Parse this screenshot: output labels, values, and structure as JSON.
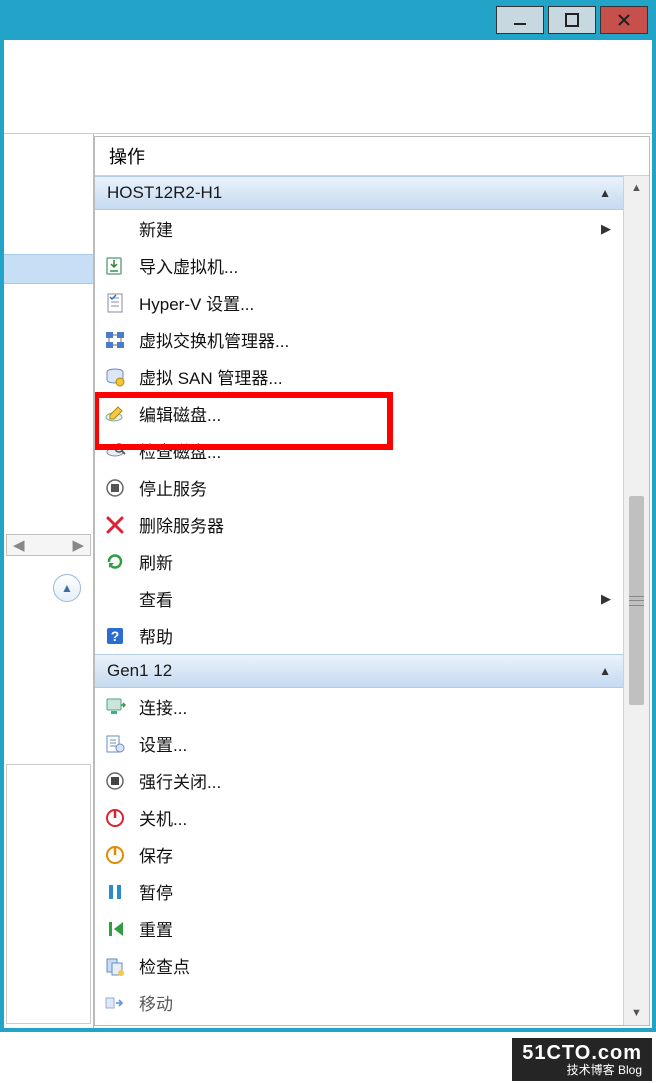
{
  "pane_title": "操作",
  "sections": {
    "host": {
      "title": "HOST12R2-H1"
    },
    "vm": {
      "title": "Gen1 12"
    }
  },
  "host_actions": {
    "new": "新建",
    "import_vm": "导入虚拟机...",
    "hyperv_settings": "Hyper-V 设置...",
    "vswitch_manager": "虚拟交换机管理器...",
    "vsan_manager": "虚拟 SAN 管理器...",
    "edit_disk": "编辑磁盘...",
    "inspect_disk": "检查磁盘...",
    "stop_service": "停止服务",
    "remove_server": "删除服务器",
    "refresh": "刷新",
    "view": "查看",
    "help": "帮助"
  },
  "vm_actions": {
    "connect": "连接...",
    "settings": "设置...",
    "turn_off": "强行关闭...",
    "shut_down": "关机...",
    "save": "保存",
    "pause": "暂停",
    "reset": "重置",
    "checkpoint": "检查点",
    "move": "移动"
  },
  "watermark": {
    "line1": "51CTO.com",
    "line2": "技术博客  Blog"
  }
}
